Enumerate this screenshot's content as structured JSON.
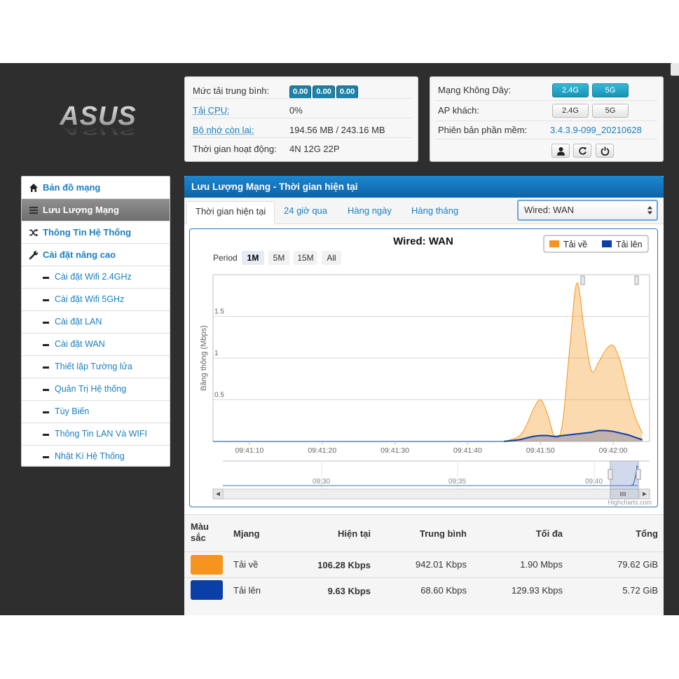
{
  "logo": {
    "text": "ASUS"
  },
  "system_status": {
    "load_label": "Mức tải trung bình:",
    "load_values": [
      "0.00",
      "0.00",
      "0.00"
    ],
    "cpu_label": "Tải CPU:",
    "cpu_value": "0%",
    "mem_label": "Bộ nhớ còn lại:",
    "mem_value": "194.56 MB / 243.16 MB",
    "uptime_label": "Thời gian hoạt động:",
    "uptime_value": "4N 12G 22P"
  },
  "wireless_status": {
    "wifi_label": "Mạng Không Dây:",
    "wifi_buttons": [
      "2.4G",
      "5G"
    ],
    "guest_label": "AP khách:",
    "guest_buttons": [
      "2.4G",
      "5G"
    ],
    "firmware_label": "Phiên bản phần mềm:",
    "firmware_value": "3.4.3.9-099_20210628",
    "icons": [
      "user-icon",
      "refresh-icon",
      "power-icon"
    ]
  },
  "sidebar": {
    "items": [
      {
        "label": "Bản đồ mạng",
        "icon": "home-icon"
      },
      {
        "label": "Lưu Lượng Mạng",
        "icon": "list-icon"
      },
      {
        "label": "Thông Tin Hệ Thống",
        "icon": "shuffle-icon"
      },
      {
        "label": "Cài đặt nâng cao",
        "icon": "wrench-icon"
      }
    ],
    "subitems": [
      "Cài đặt Wifi 2.4GHz",
      "Cài đặt Wifi 5GHz",
      "Cài đặt LAN",
      "Cài đặt WAN",
      "Thiết lập Tường lửa",
      "Quản Trị Hệ thống",
      "Tùy Biến",
      "Thông Tin LAN Và WIFI",
      "Nhật Kí Hệ Thống"
    ]
  },
  "main": {
    "title": "Lưu Lượng Mạng - Thời gian hiện tại",
    "tabs": [
      "Thời gian hiện tại",
      "24 giờ qua",
      "Hàng ngày",
      "Hàng tháng"
    ],
    "interface_select": "Wired: WAN"
  },
  "chart": {
    "period_label": "Period",
    "period_buttons": [
      "1M",
      "5M",
      "15M",
      "All"
    ],
    "credit": "Highcharts.com",
    "navigator_ticks": [
      "09:30",
      "09:35",
      "09:40"
    ]
  },
  "chart_data": {
    "type": "area",
    "title": "Wired: WAN",
    "ylabel": "Băng thông (Mbps)",
    "ylim": [
      0,
      2
    ],
    "yticks": [
      0.5,
      1,
      1.5
    ],
    "xticks": [
      "09:41:10",
      "09:41:20",
      "09:41:30",
      "09:41:40",
      "09:41:50",
      "09:42:00"
    ],
    "grid": true,
    "legend_position": "top-right",
    "series": [
      {
        "name": "Tải về",
        "color": "#f7941d",
        "x": [
          "09:41:45",
          "09:41:47",
          "09:41:48",
          "09:41:49",
          "09:41:50",
          "09:41:51",
          "09:41:52",
          "09:41:53",
          "09:41:54",
          "09:41:55",
          "09:41:56",
          "09:41:57",
          "09:41:58",
          "09:41:59",
          "09:42:00",
          "09:42:01",
          "09:42:02",
          "09:42:03",
          "09:42:04"
        ],
        "values": [
          0,
          0.06,
          0.18,
          0.38,
          0.5,
          0.32,
          0.05,
          0.2,
          1.1,
          1.9,
          1.35,
          0.85,
          0.95,
          1.1,
          1.15,
          0.95,
          0.6,
          0.3,
          0.1
        ]
      },
      {
        "name": "Tải lên",
        "color": "#0b3fa8",
        "x": [
          "09:41:45",
          "09:41:47",
          "09:41:48",
          "09:41:49",
          "09:41:50",
          "09:41:51",
          "09:41:52",
          "09:41:53",
          "09:41:54",
          "09:41:55",
          "09:41:56",
          "09:41:57",
          "09:41:58",
          "09:41:59",
          "09:42:00",
          "09:42:01",
          "09:42:02",
          "09:42:03",
          "09:42:04"
        ],
        "values": [
          0,
          0.02,
          0.04,
          0.06,
          0.07,
          0.07,
          0.06,
          0.07,
          0.08,
          0.09,
          0.1,
          0.11,
          0.13,
          0.13,
          0.12,
          0.1,
          0.08,
          0.05,
          0.02
        ]
      }
    ]
  },
  "stats": {
    "headers": [
      "Màu sắc",
      "Mjang",
      "Hiện tại",
      "Trung bình",
      "Tối đa",
      "Tổng"
    ],
    "rows": [
      {
        "color": "#f7941d",
        "name": "Tải về",
        "current": "106.28 Kbps",
        "avg": "942.01 Kbps",
        "max": "1.90 Mbps",
        "total": "79.62 GiB"
      },
      {
        "color": "#0b3fa8",
        "name": "Tải lên",
        "current": "9.63 Kbps",
        "avg": "68.60 Kbps",
        "max": "129.93 Kbps",
        "total": "5.72 GiB"
      }
    ]
  }
}
